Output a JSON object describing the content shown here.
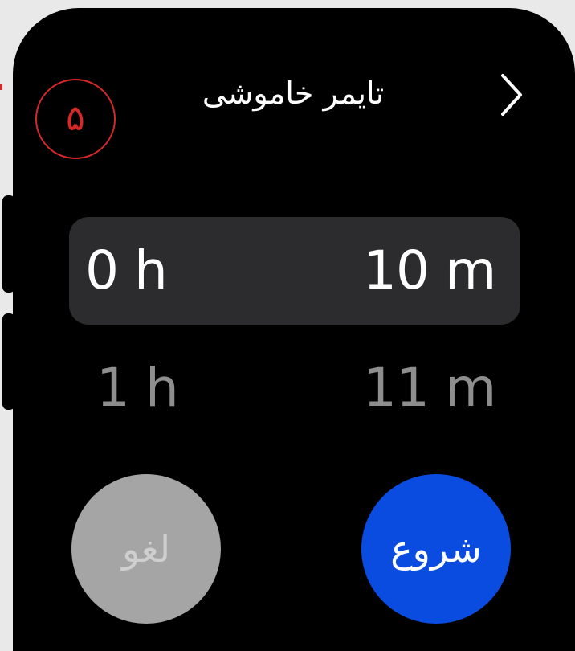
{
  "header": {
    "title": "تایمر خاموشی",
    "marker_label": "۵"
  },
  "picker": {
    "hours_selected": "0 h",
    "hours_next": "1 h",
    "minutes_selected": "10 m",
    "minutes_next": "11 m"
  },
  "buttons": {
    "cancel_label": "لغو",
    "start_label": "شروع"
  },
  "colors": {
    "background": "#000000",
    "picker_highlight": "#2c2c2e",
    "start_button": "#0a4be0",
    "cancel_button": "#a5a5a5",
    "marker": "#d62828"
  },
  "icons": {
    "forward": "chevron-right-icon"
  }
}
